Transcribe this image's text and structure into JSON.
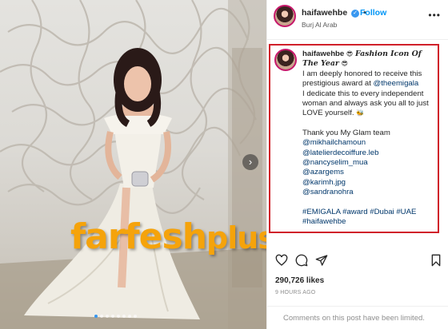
{
  "post": {
    "username": "haifawehbe",
    "verified_mark": "✓",
    "follow_label": "Follow",
    "location": "Burj Al Arab",
    "more_label": "•••"
  },
  "caption": {
    "username": "haifawehbe",
    "headline": "Fashion Icon Of The Year",
    "line1": "I am deeply honored to receive this prestigious award at ",
    "mention_award": "@theemigala",
    "line2": "I dedicate this to every independent woman and always ask you all to just LOVE yourself.",
    "thanks": "Thank you My Glam team",
    "team": [
      "@mikhailchamoun",
      "@latelierdecoiffure.leb",
      "@nancyselim_mua",
      "@azargems",
      "@karimh.jpg",
      "@sandranohra"
    ],
    "hashtags_line1": "#EMIGALA #award #Dubai #UAE",
    "hashtags_line2": "#haifawehbe"
  },
  "stats": {
    "likes": "290,726 likes",
    "time": "9 HOURS AGO",
    "comments_notice": "Comments on this post have been limited."
  },
  "watermark": {
    "part1": "farfesh",
    "part2": "plus.com"
  },
  "carousel": {
    "next_glyph": "›",
    "slides": 8,
    "active": 0
  },
  "icons": [
    "heart-icon",
    "comment-icon",
    "share-icon",
    "bookmark-icon",
    "sunglasses-emoji-icon",
    "bee-emoji-icon"
  ],
  "colors": {
    "highlight_border": "#d0202a",
    "follow_blue": "#0095f6",
    "link": "#00376b",
    "watermark": "#f5a30b"
  }
}
